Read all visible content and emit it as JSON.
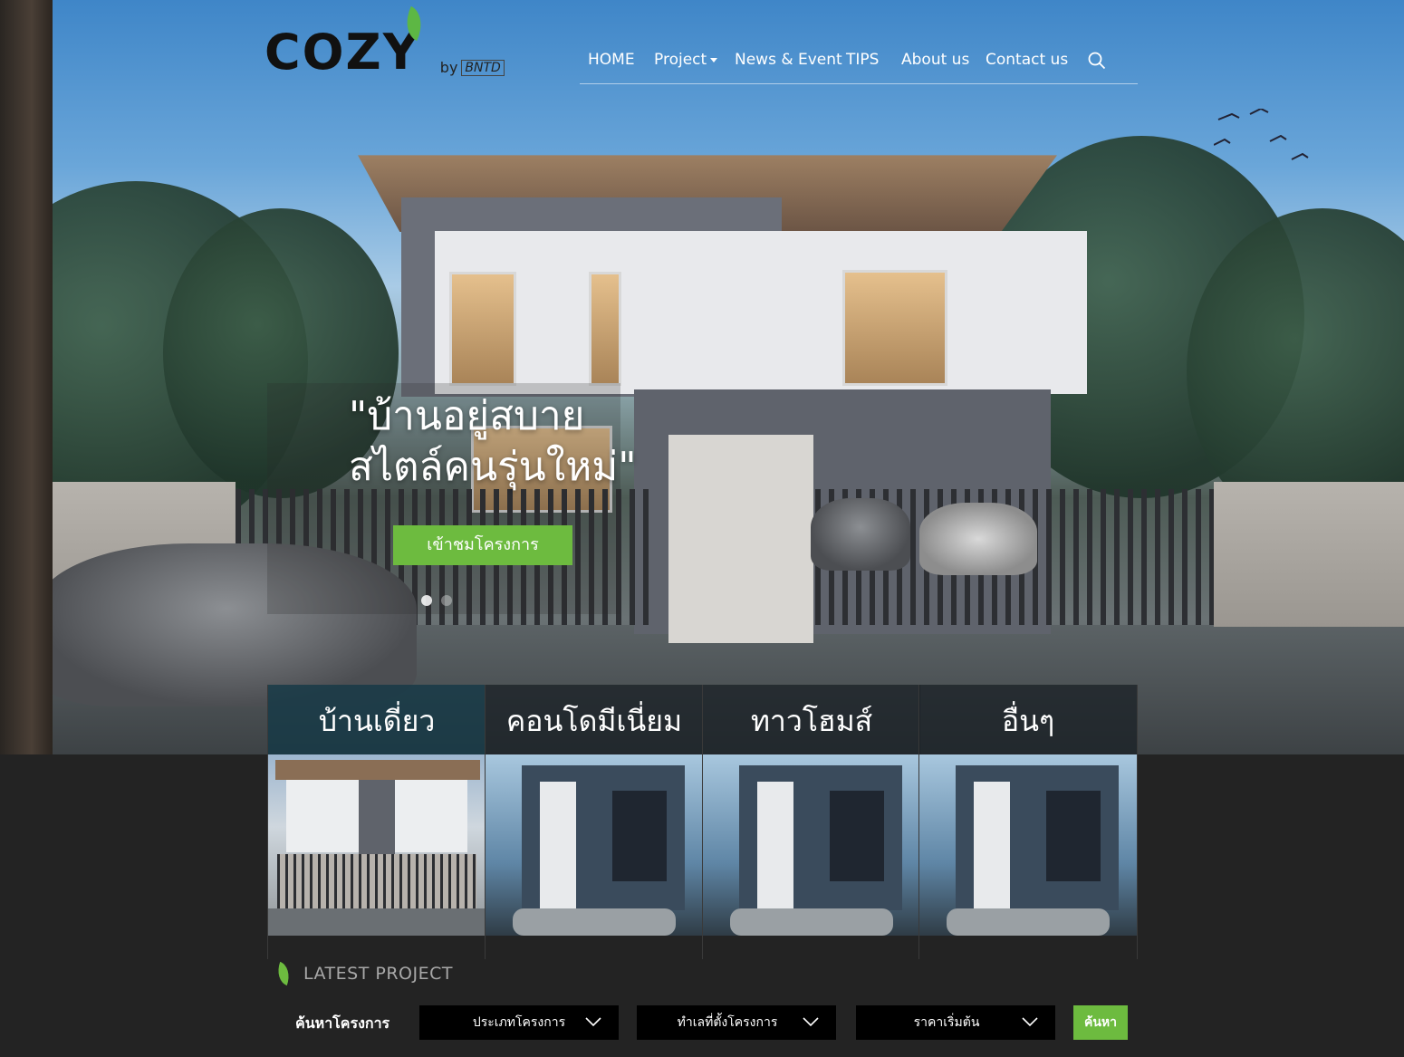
{
  "brand": {
    "logo": "COZY",
    "by": "by",
    "company": "BNTD"
  },
  "nav": {
    "items": [
      {
        "label": "HOME"
      },
      {
        "label": "Project",
        "dropdown": true
      },
      {
        "label": "News & Event"
      },
      {
        "label": "TIPS"
      },
      {
        "label": "About us"
      },
      {
        "label": "Contact us"
      }
    ],
    "search_icon": "search-icon"
  },
  "hero": {
    "line1": "\"บ้านอยู่สบาย",
    "line2": "สไตล์คนรุ่นใหม่\"",
    "cta": "เข้าชมโครงการ",
    "slides": 2,
    "active_slide": 1
  },
  "categories": [
    {
      "label": "บ้านเดี่ยว",
      "active": true
    },
    {
      "label": "คอนโดมีเนี่ยม",
      "active": false
    },
    {
      "label": "ทาวโฮมส์",
      "active": false
    },
    {
      "label": "อื่นๆ",
      "active": false
    }
  ],
  "latest": {
    "title": "LATEST PROJECT"
  },
  "search": {
    "label": "ค้นหาโครงการ",
    "type": "ประเภทโครงการ",
    "location": "ทำเลที่ตั้งโครงการ",
    "price": "ราคาเริ่มต้น",
    "submit": "ค้นหา"
  },
  "colors": {
    "accent": "#6dbb3f",
    "background": "#232323"
  }
}
